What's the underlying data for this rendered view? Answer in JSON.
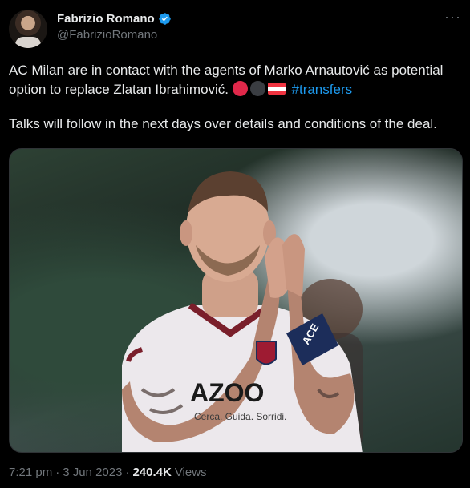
{
  "author": {
    "display_name": "Fabrizio Romano",
    "handle": "@FabrizioRomano",
    "verified_icon": "verified-badge-icon"
  },
  "more_icon": "more-options-icon",
  "tweet": {
    "line1": "AC Milan are in contact with the agents of Marko Arnautović as potential option to replace Zlatan Ibrahimović.",
    "emojis": [
      "red-circle-emoji",
      "black-circle-emoji",
      "austria-flag-emoji"
    ],
    "hashtag": "#transfers",
    "line2": "Talks will follow in the next days over details and conditions of the deal."
  },
  "media": {
    "shirt_sponsor": "AZOO",
    "shirt_slogan": "Cerca. Guida. Sorridi.",
    "armband_text": "ACE"
  },
  "colors": {
    "background": "#000000",
    "text": "#e7e9ea",
    "muted": "#71767b",
    "link": "#1d9bf0"
  },
  "footer": {
    "time": "7:21 pm",
    "date": "3 Jun 2023",
    "views_count": "240.4K",
    "views_label": "Views"
  }
}
